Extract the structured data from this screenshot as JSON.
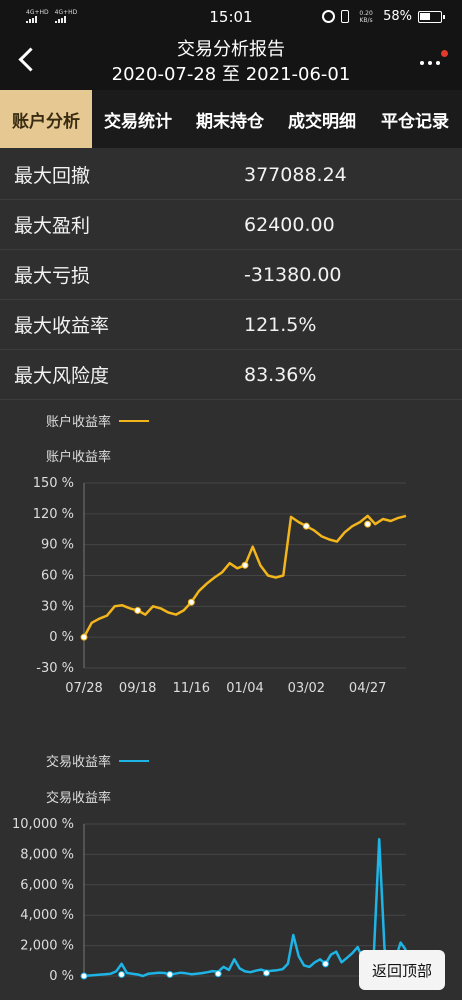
{
  "status_bar": {
    "time": "15:01",
    "signal1": "4G+HD",
    "signal2": "4G+HD",
    "speed": "0.20 KB/s",
    "battery": "58%"
  },
  "header": {
    "title": "交易分析报告",
    "subtitle": "2020-07-28 至 2021-06-01"
  },
  "tabs": [
    {
      "label": "账户分析",
      "active": true
    },
    {
      "label": "交易统计"
    },
    {
      "label": "期末持仓"
    },
    {
      "label": "成交明细"
    },
    {
      "label": "平仓记录"
    }
  ],
  "metrics": [
    {
      "label": "最大回撤",
      "value": "377088.24"
    },
    {
      "label": "最大盈利",
      "value": "62400.00"
    },
    {
      "label": "最大亏损",
      "value": "-31380.00"
    },
    {
      "label": "最大收益率",
      "value": "121.5%"
    },
    {
      "label": "最大风险度",
      "value": "83.36%"
    }
  ],
  "colors": {
    "account_line": "#f2b51c",
    "trade_line": "#1eb4e6",
    "active_tab_bg": "#e6c893"
  },
  "back_to_top_label": "返回顶部",
  "chart_data": [
    {
      "type": "line",
      "title": "账户收益率",
      "series": [
        {
          "name": "账户收益率",
          "color": "#f2b51c",
          "x": [
            "07/28",
            "08/04",
            "08/10",
            "08/18",
            "08/26",
            "09/02",
            "09/10",
            "09/18",
            "09/25",
            "10/05",
            "10/14",
            "10/22",
            "10/30",
            "11/07",
            "11/16",
            "11/23",
            "11/30",
            "12/07",
            "12/14",
            "12/21",
            "12/28",
            "01/04",
            "01/11",
            "01/18",
            "01/25",
            "02/01",
            "02/08",
            "02/15",
            "02/22",
            "03/02",
            "03/09",
            "03/16",
            "03/23",
            "03/30",
            "04/06",
            "04/13",
            "04/20",
            "04/27",
            "05/04",
            "05/11",
            "05/18",
            "05/25",
            "06/01"
          ],
          "y": [
            0,
            14,
            18,
            21,
            30,
            31,
            28,
            26,
            22,
            30,
            28,
            24,
            22,
            26,
            34,
            45,
            52,
            58,
            63,
            72,
            67,
            70,
            88,
            70,
            60,
            58,
            60,
            117,
            112,
            108,
            104,
            98,
            95,
            93,
            102,
            108,
            112,
            118,
            110,
            115,
            113,
            116,
            118
          ],
          "markers": [
            {
              "x": "07/28",
              "y": 0
            },
            {
              "x": "09/18",
              "y": 26
            },
            {
              "x": "11/16",
              "y": 34
            },
            {
              "x": "01/04",
              "y": 70
            },
            {
              "x": "03/02",
              "y": 108
            },
            {
              "x": "04/27",
              "y": 110
            }
          ]
        }
      ],
      "xticks": [
        "07/28",
        "09/18",
        "11/16",
        "01/04",
        "03/02",
        "04/27"
      ],
      "yticks": [
        "150 %",
        "120 %",
        "90 %",
        "60 %",
        "30 %",
        "0 %",
        "-30 %"
      ],
      "ylim": [
        -30,
        150
      ],
      "grid": true,
      "legend": "top-left"
    },
    {
      "type": "line",
      "title": "交易收益率",
      "series": [
        {
          "name": "交易收益率",
          "color": "#1eb4e6",
          "x": [
            0,
            5,
            10,
            15,
            20,
            25,
            30,
            35,
            40,
            45,
            50,
            55,
            60,
            65,
            70,
            75,
            80,
            85,
            90,
            95,
            100,
            105,
            110,
            115,
            120,
            125,
            130,
            135,
            140,
            145,
            150,
            155,
            160,
            165,
            170,
            175,
            180,
            185,
            190,
            195,
            200,
            205,
            210,
            215,
            220,
            225,
            230,
            235,
            240,
            245,
            250,
            255,
            260,
            265,
            270,
            275,
            280,
            285,
            290,
            295,
            300
          ],
          "y": [
            0,
            30,
            60,
            90,
            120,
            150,
            300,
            800,
            200,
            150,
            100,
            0,
            150,
            180,
            220,
            200,
            100,
            150,
            220,
            180,
            120,
            150,
            190,
            250,
            320,
            280,
            600,
            400,
            1100,
            500,
            300,
            250,
            350,
            420,
            300,
            350,
            380,
            450,
            800,
            2700,
            1300,
            700,
            600,
            900,
            1100,
            800,
            1400,
            1600,
            900,
            1200,
            1500,
            1900,
            1100,
            1300,
            1400,
            9000,
            1800,
            700,
            1100,
            2200,
            1700
          ],
          "markers": [
            {
              "x": 0,
              "y": 0
            },
            {
              "x": 35,
              "y": 100
            },
            {
              "x": 80,
              "y": 100
            },
            {
              "x": 125,
              "y": 150
            },
            {
              "x": 170,
              "y": 200
            },
            {
              "x": 225,
              "y": 800
            }
          ]
        }
      ],
      "yticks": [
        "10,000 %",
        "8,000 %",
        "6,000 %",
        "4,000 %",
        "2,000 %",
        "0 %"
      ],
      "ylim": [
        0,
        10000
      ],
      "grid": true,
      "legend": "top-left"
    }
  ]
}
